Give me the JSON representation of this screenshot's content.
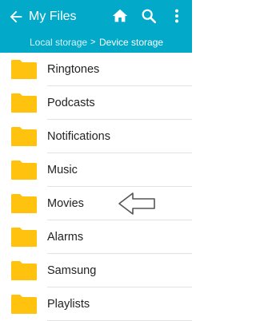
{
  "header": {
    "back_icon": "arrow-left-icon",
    "title": "My Files",
    "actions": [
      {
        "id": "home",
        "icon": "home-icon"
      },
      {
        "id": "search",
        "icon": "search-icon"
      },
      {
        "id": "more",
        "icon": "more-vertical-icon"
      }
    ],
    "breadcrumb": {
      "root": "Local storage",
      "separator": ">",
      "current": "Device storage"
    },
    "colors": {
      "bar": "#03a9c9",
      "folder": "#ffc20e"
    }
  },
  "folders": [
    {
      "name": "Ringtones",
      "icon": "folder-icon"
    },
    {
      "name": "Podcasts",
      "icon": "folder-icon"
    },
    {
      "name": "Notifications",
      "icon": "folder-icon"
    },
    {
      "name": "Music",
      "icon": "folder-icon"
    },
    {
      "name": "Movies",
      "icon": "folder-icon",
      "highlighted": true
    },
    {
      "name": "Alarms",
      "icon": "folder-icon"
    },
    {
      "name": "Samsung",
      "icon": "folder-icon"
    },
    {
      "name": "Playlists",
      "icon": "folder-icon"
    }
  ],
  "annotation": {
    "icon": "left-arrow-outline-icon",
    "points_to": "Movies"
  }
}
